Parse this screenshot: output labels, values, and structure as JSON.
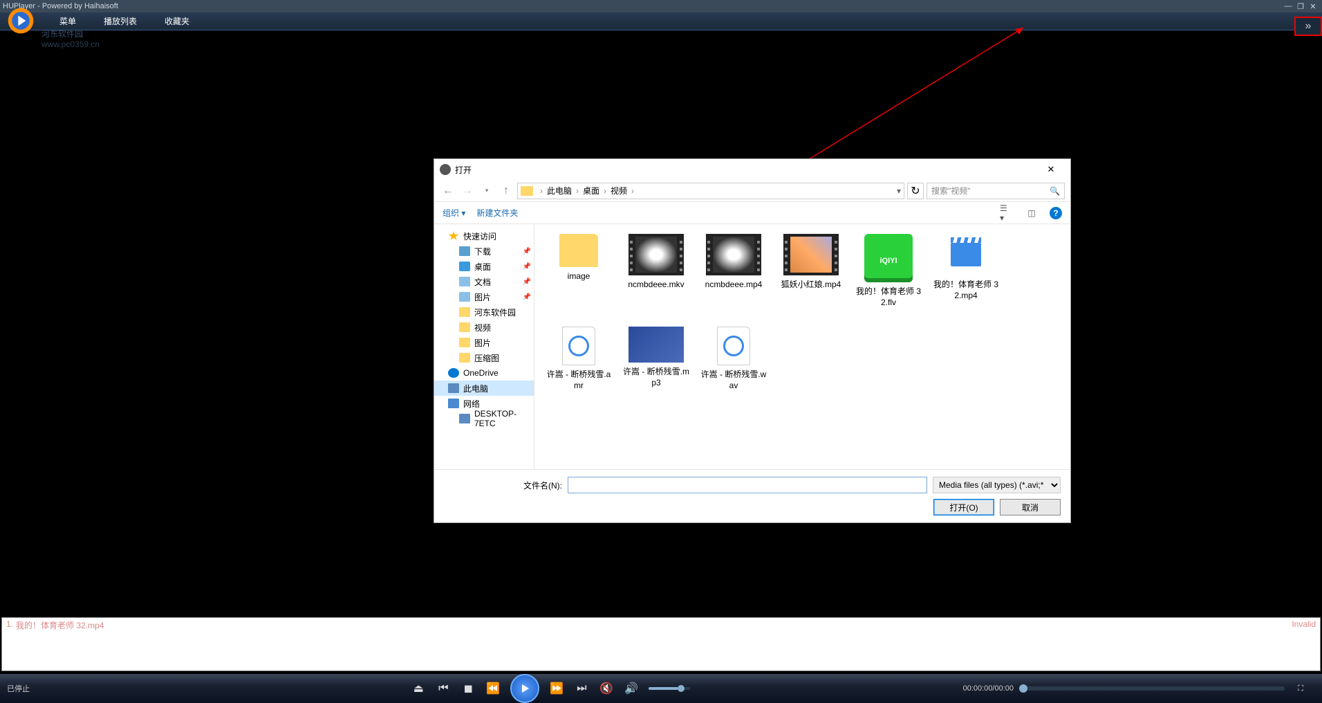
{
  "app": {
    "title": "HUPlayer - Powered by Haihaisoft",
    "watermark_top": "河东软件园",
    "watermark_url": "www.pc0359.cn"
  },
  "menu": {
    "items": [
      "菜单",
      "播放列表",
      "收藏夹"
    ]
  },
  "playlist": {
    "item1_index": "1.",
    "item1_name": "我的！体育老师 32.mp4",
    "item1_status": "Invalid"
  },
  "controls": {
    "status": "已停止",
    "time": "00:00:00/00:00"
  },
  "dialog": {
    "title": "打开",
    "breadcrumb": [
      "此电脑",
      "桌面",
      "视频"
    ],
    "search_placeholder": "搜索\"视频\"",
    "toolbar": {
      "organize": "组织",
      "newfolder": "新建文件夹"
    },
    "tree": [
      {
        "icon": "star",
        "label": "快速访问",
        "indent": false
      },
      {
        "icon": "down",
        "label": "下载",
        "indent": true,
        "pin": true
      },
      {
        "icon": "desktop",
        "label": "桌面",
        "indent": true,
        "pin": true
      },
      {
        "icon": "doc",
        "label": "文档",
        "indent": true,
        "pin": true
      },
      {
        "icon": "doc",
        "label": "图片",
        "indent": true,
        "pin": true
      },
      {
        "icon": "folder",
        "label": "河东软件园",
        "indent": true
      },
      {
        "icon": "folder",
        "label": "视频",
        "indent": true
      },
      {
        "icon": "folder",
        "label": "图片",
        "indent": true
      },
      {
        "icon": "folder",
        "label": "压缩图",
        "indent": true
      },
      {
        "icon": "cloud",
        "label": "OneDrive",
        "indent": false
      },
      {
        "icon": "pc",
        "label": "此电脑",
        "indent": false,
        "selected": true
      },
      {
        "icon": "net",
        "label": "网络",
        "indent": false
      },
      {
        "icon": "pc",
        "label": "DESKTOP-7ETC",
        "indent": true
      }
    ],
    "files": [
      {
        "type": "folder",
        "label": "image"
      },
      {
        "type": "video-car",
        "label": "ncmbdeee.mkv"
      },
      {
        "type": "video-car",
        "label": "ncmbdeee.mp4"
      },
      {
        "type": "video-anime",
        "label": "狐妖小红娘.mp4"
      },
      {
        "type": "iqiyi",
        "label": "我的！体育老师 32.flv"
      },
      {
        "type": "mp4",
        "label": "我的！体育老师 32.mp4"
      },
      {
        "type": "audio",
        "label": "许嵩 - 断桥残雪.amr"
      },
      {
        "type": "mp3img",
        "label": "许嵩 - 断桥残雪.mp3"
      },
      {
        "type": "audio",
        "label": "许嵩 - 断桥残雪.wav"
      }
    ],
    "filename_label": "文件名(N):",
    "filetype": "Media files (all types) (*.avi;*",
    "open_btn": "打开(O)",
    "cancel_btn": "取消"
  }
}
